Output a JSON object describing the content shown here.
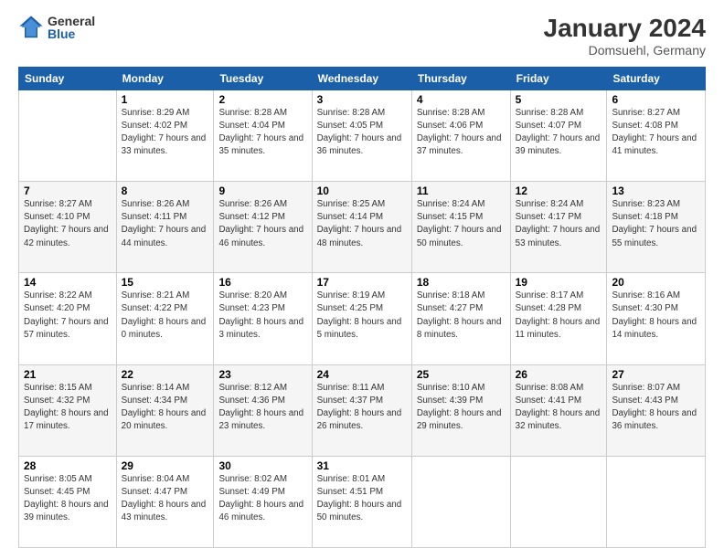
{
  "logo": {
    "general": "General",
    "blue": "Blue"
  },
  "title": "January 2024",
  "subtitle": "Domsuehl, Germany",
  "days_header": [
    "Sunday",
    "Monday",
    "Tuesday",
    "Wednesday",
    "Thursday",
    "Friday",
    "Saturday"
  ],
  "weeks": [
    [
      {
        "num": "",
        "sunrise": "",
        "sunset": "",
        "daylight": ""
      },
      {
        "num": "1",
        "sunrise": "Sunrise: 8:29 AM",
        "sunset": "Sunset: 4:02 PM",
        "daylight": "Daylight: 7 hours and 33 minutes."
      },
      {
        "num": "2",
        "sunrise": "Sunrise: 8:28 AM",
        "sunset": "Sunset: 4:04 PM",
        "daylight": "Daylight: 7 hours and 35 minutes."
      },
      {
        "num": "3",
        "sunrise": "Sunrise: 8:28 AM",
        "sunset": "Sunset: 4:05 PM",
        "daylight": "Daylight: 7 hours and 36 minutes."
      },
      {
        "num": "4",
        "sunrise": "Sunrise: 8:28 AM",
        "sunset": "Sunset: 4:06 PM",
        "daylight": "Daylight: 7 hours and 37 minutes."
      },
      {
        "num": "5",
        "sunrise": "Sunrise: 8:28 AM",
        "sunset": "Sunset: 4:07 PM",
        "daylight": "Daylight: 7 hours and 39 minutes."
      },
      {
        "num": "6",
        "sunrise": "Sunrise: 8:27 AM",
        "sunset": "Sunset: 4:08 PM",
        "daylight": "Daylight: 7 hours and 41 minutes."
      }
    ],
    [
      {
        "num": "7",
        "sunrise": "Sunrise: 8:27 AM",
        "sunset": "Sunset: 4:10 PM",
        "daylight": "Daylight: 7 hours and 42 minutes."
      },
      {
        "num": "8",
        "sunrise": "Sunrise: 8:26 AM",
        "sunset": "Sunset: 4:11 PM",
        "daylight": "Daylight: 7 hours and 44 minutes."
      },
      {
        "num": "9",
        "sunrise": "Sunrise: 8:26 AM",
        "sunset": "Sunset: 4:12 PM",
        "daylight": "Daylight: 7 hours and 46 minutes."
      },
      {
        "num": "10",
        "sunrise": "Sunrise: 8:25 AM",
        "sunset": "Sunset: 4:14 PM",
        "daylight": "Daylight: 7 hours and 48 minutes."
      },
      {
        "num": "11",
        "sunrise": "Sunrise: 8:24 AM",
        "sunset": "Sunset: 4:15 PM",
        "daylight": "Daylight: 7 hours and 50 minutes."
      },
      {
        "num": "12",
        "sunrise": "Sunrise: 8:24 AM",
        "sunset": "Sunset: 4:17 PM",
        "daylight": "Daylight: 7 hours and 53 minutes."
      },
      {
        "num": "13",
        "sunrise": "Sunrise: 8:23 AM",
        "sunset": "Sunset: 4:18 PM",
        "daylight": "Daylight: 7 hours and 55 minutes."
      }
    ],
    [
      {
        "num": "14",
        "sunrise": "Sunrise: 8:22 AM",
        "sunset": "Sunset: 4:20 PM",
        "daylight": "Daylight: 7 hours and 57 minutes."
      },
      {
        "num": "15",
        "sunrise": "Sunrise: 8:21 AM",
        "sunset": "Sunset: 4:22 PM",
        "daylight": "Daylight: 8 hours and 0 minutes."
      },
      {
        "num": "16",
        "sunrise": "Sunrise: 8:20 AM",
        "sunset": "Sunset: 4:23 PM",
        "daylight": "Daylight: 8 hours and 3 minutes."
      },
      {
        "num": "17",
        "sunrise": "Sunrise: 8:19 AM",
        "sunset": "Sunset: 4:25 PM",
        "daylight": "Daylight: 8 hours and 5 minutes."
      },
      {
        "num": "18",
        "sunrise": "Sunrise: 8:18 AM",
        "sunset": "Sunset: 4:27 PM",
        "daylight": "Daylight: 8 hours and 8 minutes."
      },
      {
        "num": "19",
        "sunrise": "Sunrise: 8:17 AM",
        "sunset": "Sunset: 4:28 PM",
        "daylight": "Daylight: 8 hours and 11 minutes."
      },
      {
        "num": "20",
        "sunrise": "Sunrise: 8:16 AM",
        "sunset": "Sunset: 4:30 PM",
        "daylight": "Daylight: 8 hours and 14 minutes."
      }
    ],
    [
      {
        "num": "21",
        "sunrise": "Sunrise: 8:15 AM",
        "sunset": "Sunset: 4:32 PM",
        "daylight": "Daylight: 8 hours and 17 minutes."
      },
      {
        "num": "22",
        "sunrise": "Sunrise: 8:14 AM",
        "sunset": "Sunset: 4:34 PM",
        "daylight": "Daylight: 8 hours and 20 minutes."
      },
      {
        "num": "23",
        "sunrise": "Sunrise: 8:12 AM",
        "sunset": "Sunset: 4:36 PM",
        "daylight": "Daylight: 8 hours and 23 minutes."
      },
      {
        "num": "24",
        "sunrise": "Sunrise: 8:11 AM",
        "sunset": "Sunset: 4:37 PM",
        "daylight": "Daylight: 8 hours and 26 minutes."
      },
      {
        "num": "25",
        "sunrise": "Sunrise: 8:10 AM",
        "sunset": "Sunset: 4:39 PM",
        "daylight": "Daylight: 8 hours and 29 minutes."
      },
      {
        "num": "26",
        "sunrise": "Sunrise: 8:08 AM",
        "sunset": "Sunset: 4:41 PM",
        "daylight": "Daylight: 8 hours and 32 minutes."
      },
      {
        "num": "27",
        "sunrise": "Sunrise: 8:07 AM",
        "sunset": "Sunset: 4:43 PM",
        "daylight": "Daylight: 8 hours and 36 minutes."
      }
    ],
    [
      {
        "num": "28",
        "sunrise": "Sunrise: 8:05 AM",
        "sunset": "Sunset: 4:45 PM",
        "daylight": "Daylight: 8 hours and 39 minutes."
      },
      {
        "num": "29",
        "sunrise": "Sunrise: 8:04 AM",
        "sunset": "Sunset: 4:47 PM",
        "daylight": "Daylight: 8 hours and 43 minutes."
      },
      {
        "num": "30",
        "sunrise": "Sunrise: 8:02 AM",
        "sunset": "Sunset: 4:49 PM",
        "daylight": "Daylight: 8 hours and 46 minutes."
      },
      {
        "num": "31",
        "sunrise": "Sunrise: 8:01 AM",
        "sunset": "Sunset: 4:51 PM",
        "daylight": "Daylight: 8 hours and 50 minutes."
      },
      {
        "num": "",
        "sunrise": "",
        "sunset": "",
        "daylight": ""
      },
      {
        "num": "",
        "sunrise": "",
        "sunset": "",
        "daylight": ""
      },
      {
        "num": "",
        "sunrise": "",
        "sunset": "",
        "daylight": ""
      }
    ]
  ]
}
